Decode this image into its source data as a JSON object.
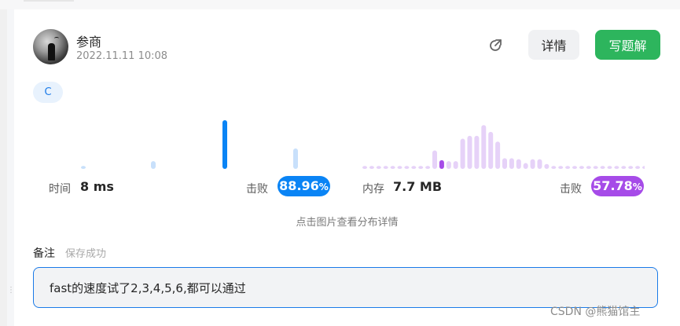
{
  "post": {
    "author": "参商",
    "timestamp": "2022.11.11 10:08",
    "language": "C"
  },
  "actions": {
    "share_icon": "share-external-icon",
    "detail_label": "详情",
    "write_label": "写题解"
  },
  "runtime": {
    "label": "时间",
    "value": "8 ms",
    "beat_label": "击败",
    "beat_main": "88.96",
    "beat_unit": "%"
  },
  "memory": {
    "label": "内存",
    "value": "7.7 MB",
    "beat_label": "击败",
    "beat_main": "57.78",
    "beat_unit": "%"
  },
  "hint": "点击图片查看分布详情",
  "note": {
    "label": "备注",
    "status": "保存成功",
    "text": "fast的速度试了2,3,4,5,6,都可以通过"
  },
  "watermark": "CSDN @熊猫馆主",
  "colors": {
    "accent_blue": "#0a84f5",
    "light_blue": "#c8e0fb",
    "accent_purple": "#a64be8",
    "light_purple": "#e6d2f8",
    "green": "#2db55d"
  },
  "chart_data": [
    {
      "type": "bar",
      "name_hint": "runtime-distribution",
      "values": [
        0.06,
        0.16,
        1.0,
        0.42
      ],
      "highlight_index": 2
    },
    {
      "type": "bar",
      "name_hint": "memory-distribution",
      "values": [
        0.06,
        0.06,
        0.06,
        0.06,
        0.06,
        0.06,
        0.06,
        0.06,
        0.06,
        0.06,
        0.38,
        0.18,
        0.16,
        0.16,
        0.62,
        0.68,
        0.68,
        0.9,
        0.76,
        0.56,
        0.22,
        0.22,
        0.2,
        0.12,
        0.2,
        0.2,
        0.1,
        0.06,
        0.06,
        0.06,
        0.06,
        0.06,
        0.06,
        0.06,
        0.06,
        0.06,
        0.06,
        0.06,
        0.06,
        0.06,
        0.06
      ],
      "highlight_index": 11
    }
  ]
}
